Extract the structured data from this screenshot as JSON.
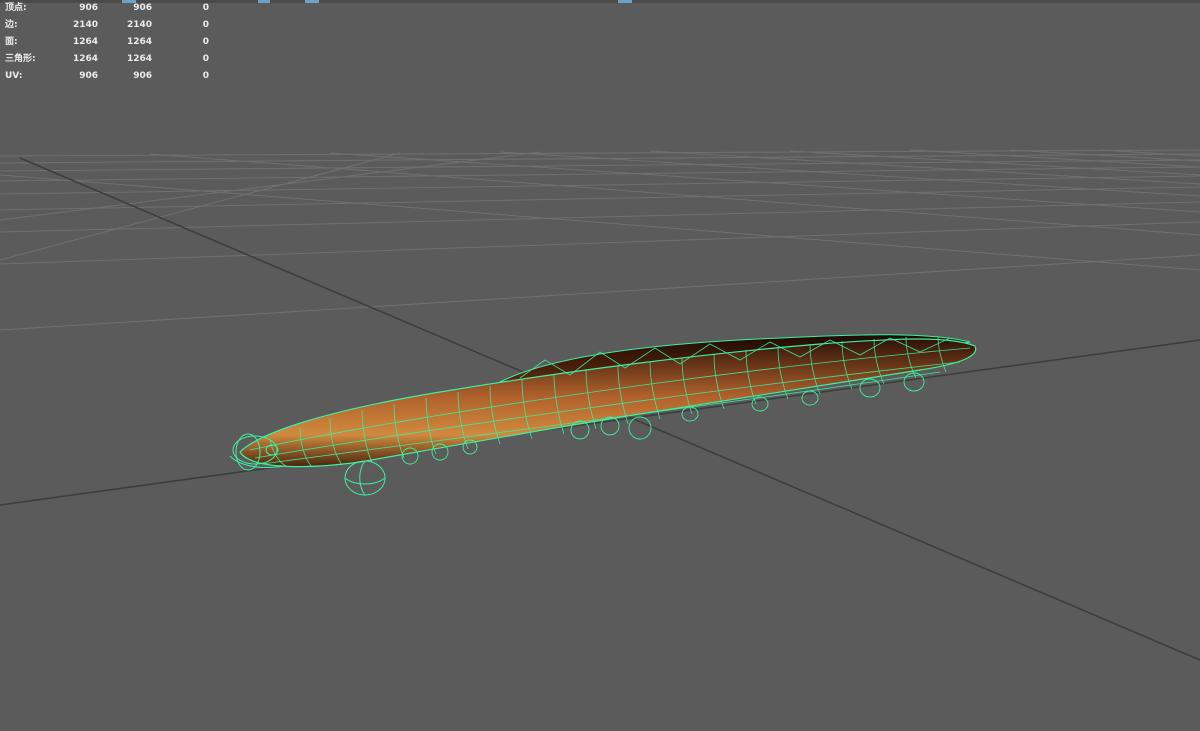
{
  "hud": {
    "rows": [
      {
        "label": "顶点:",
        "values": [
          "906",
          "906",
          "0"
        ]
      },
      {
        "label": "边:",
        "values": [
          "2140",
          "2140",
          "0"
        ]
      },
      {
        "label": "面:",
        "values": [
          "1264",
          "1264",
          "0"
        ]
      },
      {
        "label": "三角形:",
        "values": [
          "1264",
          "1264",
          "0"
        ]
      },
      {
        "label": "UV:",
        "values": [
          "906",
          "906",
          "0"
        ]
      }
    ]
  },
  "colors": {
    "background": "#5b5b5b",
    "grid": "#6e6e6e",
    "axis": "#3a3a3a",
    "wireframe": "#3df0a0",
    "body_dark": "#3a1a0c",
    "body_light": "#c06a30"
  },
  "icons": {
    "object": "eel-mesh-wireframe"
  }
}
